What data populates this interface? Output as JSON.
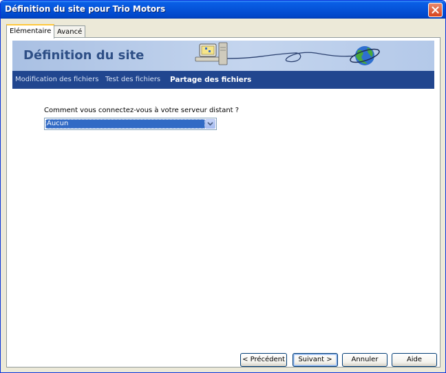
{
  "window": {
    "title": "Définition du site pour Trio Motors",
    "close_icon": "close-icon"
  },
  "tabs": [
    {
      "label": "Elémentaire",
      "active": true
    },
    {
      "label": "Avancé",
      "active": false
    }
  ],
  "banner": {
    "title": "Définition du site",
    "art": "computer-to-globe-network-illustration"
  },
  "steps": [
    {
      "label": "Modification des fichiers",
      "current": false
    },
    {
      "label": "Test des fichiers",
      "current": false
    },
    {
      "label": "Partage des fichiers",
      "current": true
    }
  ],
  "form": {
    "question": "Comment vous connectez-vous à votre serveur distant ?",
    "connection_select": {
      "value": "Aucun",
      "icon": "chevron-down-icon"
    }
  },
  "buttons": {
    "previous": "< Précédent",
    "next": "Suivant >",
    "cancel": "Annuler",
    "help": "Aide"
  },
  "colors": {
    "titlebar": "#0553d8",
    "steps_bar": "#21468f",
    "banner_title": "#2e4f86",
    "selection": "#316ac5"
  }
}
